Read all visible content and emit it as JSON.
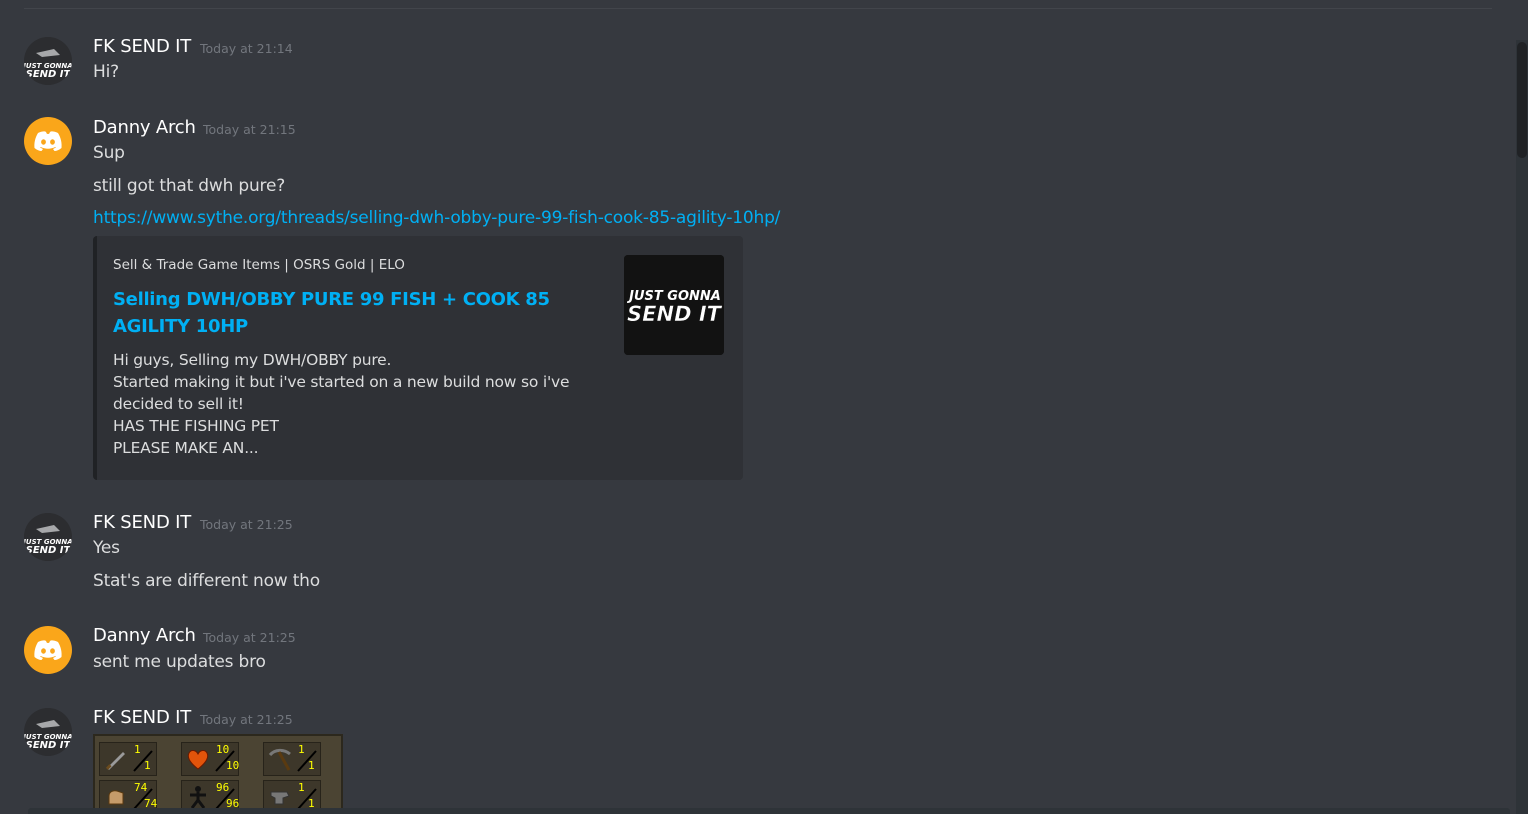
{
  "messages": [
    {
      "username": "FK SEND IT",
      "timestamp": "Today at 21:14",
      "avatar": "just-gonna-send-it-logo",
      "lines": [
        "Hi?"
      ]
    },
    {
      "username": "Danny Arch",
      "timestamp": "Today at 21:15",
      "avatar": "discord-default-avatar",
      "lines": [
        "Sup",
        "still got that dwh pure?"
      ],
      "link": "https://www.sythe.org/threads/selling-dwh-obby-pure-99-fish-cook-85-agility-10hp/",
      "embed": {
        "provider": "Sell & Trade Game Items | OSRS Gold | ELO",
        "title": "Selling DWH/OBBY PURE 99 FISH + COOK 85 AGILITY 10HP",
        "description": [
          "Hi guys, Selling my DWH/OBBY pure.",
          "Started making it but i've started on a new build now so i've",
          "decided to sell it!",
          "HAS THE FISHING PET",
          "PLEASE MAKE AN..."
        ],
        "thumbnail_text": [
          "JUST GONNA",
          "SEND IT"
        ]
      }
    },
    {
      "username": "FK SEND IT",
      "timestamp": "Today at 21:25",
      "avatar": "just-gonna-send-it-logo",
      "lines": [
        "Yes",
        "Stat's are different now tho"
      ]
    },
    {
      "username": "Danny Arch",
      "timestamp": "Today at 21:25",
      "avatar": "discord-default-avatar",
      "lines": [
        "sent me updates bro"
      ]
    },
    {
      "username": "FK SEND IT",
      "timestamp": "Today at 21:25",
      "avatar": "just-gonna-send-it-logo",
      "lines": [],
      "image": {
        "skills": [
          {
            "icon": "attack-icon",
            "current": "1",
            "max": "1"
          },
          {
            "icon": "hitpoints-icon",
            "current": "10",
            "max": "10"
          },
          {
            "icon": "mining-icon",
            "current": "1",
            "max": "1"
          },
          {
            "icon": "strength-icon",
            "current": "74",
            "max": "74"
          },
          {
            "icon": "agility-icon",
            "current": "96",
            "max": "96"
          },
          {
            "icon": "smithing-icon",
            "current": "1",
            "max": "1"
          }
        ]
      }
    }
  ],
  "colors": {
    "background": "#36393f",
    "link": "#00b0f4",
    "embed_bg": "#2f3136",
    "discord_avatar": "#faa61a"
  }
}
